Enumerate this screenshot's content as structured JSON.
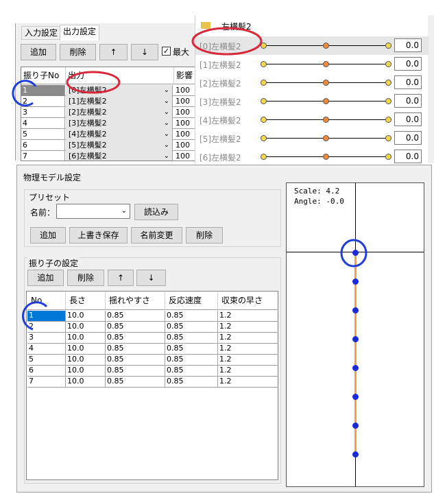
{
  "top_panel": {
    "tabs": [
      "入力設定",
      "出力設定"
    ],
    "buttons": {
      "add": "追加",
      "delete": "削除",
      "up": "↑",
      "down": "↓"
    },
    "max_checkbox_label": "最大",
    "grid_headers": {
      "no": "振り子No",
      "output": "出力",
      "influence": "影響"
    },
    "rows": [
      {
        "no": "1",
        "output": "[0]左横髪2",
        "influence": "100"
      },
      {
        "no": "2",
        "output": "[1]左横髪2",
        "influence": "100"
      },
      {
        "no": "3",
        "output": "[2]左横髪2",
        "influence": "100"
      },
      {
        "no": "4",
        "output": "[3]左横髪2",
        "influence": "100"
      },
      {
        "no": "5",
        "output": "[4]左横髪2",
        "influence": "100"
      },
      {
        "no": "6",
        "output": "[5]左横髪2",
        "influence": "100"
      },
      {
        "no": "7",
        "output": "[6]左横髪2",
        "influence": "100"
      }
    ]
  },
  "right_panel": {
    "folder_label": "左横髪2",
    "rows": [
      {
        "label": "[0]左横髪2",
        "value": "0.0"
      },
      {
        "label": "[1]左横髪2",
        "value": "0.0"
      },
      {
        "label": "[2]左横髪2",
        "value": "0.0"
      },
      {
        "label": "[3]左横髪2",
        "value": "0.0"
      },
      {
        "label": "[4]左横髪2",
        "value": "0.0"
      },
      {
        "label": "[5]左横髪2",
        "value": "0.0"
      },
      {
        "label": "[6]左横髪2",
        "value": "0.0"
      }
    ]
  },
  "physics": {
    "title": "物理モデル設定",
    "preset": {
      "title": "プリセット",
      "name_label": "名前：",
      "name_value": "",
      "load_button": "読込み",
      "buttons": {
        "add": "追加",
        "overwrite": "上書き保存",
        "rename": "名前変更",
        "delete": "削除"
      }
    },
    "pendulum": {
      "title": "振り子の設定",
      "buttons": {
        "add": "追加",
        "delete": "削除",
        "up": "↑",
        "down": "↓"
      },
      "headers": {
        "no": "No",
        "length": "長さ",
        "sway": "揺れやすさ",
        "response": "反応速度",
        "convergence": "収束の早さ"
      },
      "rows": [
        {
          "no": "1",
          "length": "10.0",
          "sway": "0.85",
          "response": "0.85",
          "convergence": "1.2"
        },
        {
          "no": "2",
          "length": "10.0",
          "sway": "0.85",
          "response": "0.85",
          "convergence": "1.2"
        },
        {
          "no": "3",
          "length": "10.0",
          "sway": "0.85",
          "response": "0.85",
          "convergence": "1.2"
        },
        {
          "no": "4",
          "length": "10.0",
          "sway": "0.85",
          "response": "0.85",
          "convergence": "1.2"
        },
        {
          "no": "5",
          "length": "10.0",
          "sway": "0.85",
          "response": "0.85",
          "convergence": "1.2"
        },
        {
          "no": "6",
          "length": "10.0",
          "sway": "0.85",
          "response": "0.85",
          "convergence": "1.2"
        },
        {
          "no": "7",
          "length": "10.0",
          "sway": "0.85",
          "response": "0.85",
          "convergence": "1.2"
        }
      ]
    },
    "preview": {
      "scale": "Scale: 4.2",
      "angle": "Angle: -0.0"
    }
  },
  "colors": {
    "selected_cell": "#0078d7",
    "knob_yellow": "#f5d94a",
    "knob_orange": "#f08a3a",
    "pendulum_node": "#1a2ad8",
    "pendulum_rope": "#f0a040",
    "annotation_red": "#d8283c",
    "annotation_blue": "#1f3ed8"
  }
}
